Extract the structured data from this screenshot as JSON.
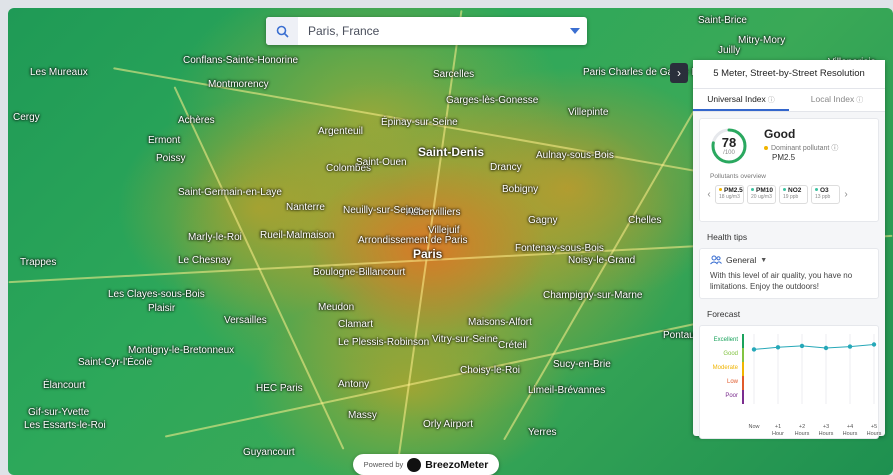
{
  "search": {
    "value": "Paris, France"
  },
  "map_labels": [
    "Saint-Denis",
    "Aubervilliers",
    "Bobigny",
    "Drancy",
    "Aulnay-sous-Bois",
    "Sarcelles",
    "Garges-lès-Gonesse",
    "Villepinte",
    "Argenteuil",
    "Épinay-sur-Seine",
    "Colombes",
    "Nanterre",
    "Neuilly-sur-Seine",
    "Rueil-Malmaison",
    "Paris",
    "Boulogne-Billancourt",
    "Meudon",
    "Versailles",
    "Clamart",
    "Le Plessis-Robinson",
    "Vitry-sur-Seine",
    "Créteil",
    "Champigny-sur-Marne",
    "Noisy-le-Grand",
    "Fontenay-sous-Bois",
    "Maisons-Alfort",
    "Choisy-le-Roi",
    "Antony",
    "Massy",
    "Orly Airport",
    "HEC Paris",
    "Guyancourt",
    "Saint-Germain-en-Laye",
    "Poissy",
    "Les Mureaux",
    "Conflans-Sainte-Honorine",
    "Cergy",
    "Chelles",
    "Montigny-le-Bretonneux",
    "Élancourt",
    "Gif-sur-Yvette",
    "Les Essarts-le-Roi",
    "Paris Charles de Gaulle International Airport",
    "Mitry-Mory",
    "Villeparisis",
    "Pontault-Combault",
    "Sucy-en-Brie",
    "Limeil-Brévannes",
    "Yerres",
    "Marly-le-Roi",
    "Le Chesnay",
    "Les Clayes-sous-Bois",
    "Plaisir",
    "Villejuif",
    "Saint-Brice",
    "Juilly",
    "Saint-Ouen",
    "Arrondissement de Paris",
    "Achères",
    "Ermont",
    "Montmorency",
    "Gagny",
    "Saint-Cyr-l'École",
    "Trappes"
  ],
  "panel": {
    "title": "5 Meter, Street-by-Street Resolution",
    "tabs": {
      "universal": "Universal Index",
      "local": "Local Index",
      "info": "ⓘ"
    },
    "aqi": {
      "value": "78",
      "scale": "/100",
      "category": "Good",
      "dominant_label": "Dominant pollutant",
      "dominant_value": "PM2.5",
      "overview_label": "Pollutants overview",
      "pollutants": [
        {
          "name": "PM2.5",
          "value": "18 ug/m3",
          "color": "#f0b400"
        },
        {
          "name": "PM10",
          "value": "20 ug/m3",
          "color": "#3cc2a0"
        },
        {
          "name": "NO2",
          "value": "19 ppb",
          "color": "#3cc2a0"
        },
        {
          "name": "O3",
          "value": "13 ppb",
          "color": "#3cc2a0"
        }
      ]
    },
    "health": {
      "title": "Health tips",
      "group": "General",
      "text": "With this level of air quality, you have no limitations. Enjoy the outdoors!"
    },
    "forecast": {
      "title": "Forecast",
      "levels": [
        "Excellent",
        "Good",
        "Moderate",
        "Low",
        "Poor"
      ],
      "level_colors": [
        "#1aa35c",
        "#82c341",
        "#f0b400",
        "#e05a2b",
        "#7b2d8e"
      ],
      "hours": [
        "Now",
        "+1 Hour",
        "+2 Hours",
        "+3 Hours",
        "+4 Hours",
        "+5 Hours"
      ]
    }
  },
  "chart_data": {
    "type": "line",
    "categories": [
      "Now",
      "+1 Hour",
      "+2 Hours",
      "+3 Hours",
      "+4 Hours",
      "+5 Hours"
    ],
    "values": [
      78,
      81,
      83,
      80,
      82,
      85
    ],
    "ylim": [
      0,
      100
    ],
    "y_ticks": [
      "Excellent",
      "Good",
      "Moderate",
      "Low",
      "Poor"
    ],
    "grid": true,
    "color": "#26a8b8"
  },
  "footer": {
    "powered_by": "Powered by",
    "brand": "BreezoMeter"
  }
}
